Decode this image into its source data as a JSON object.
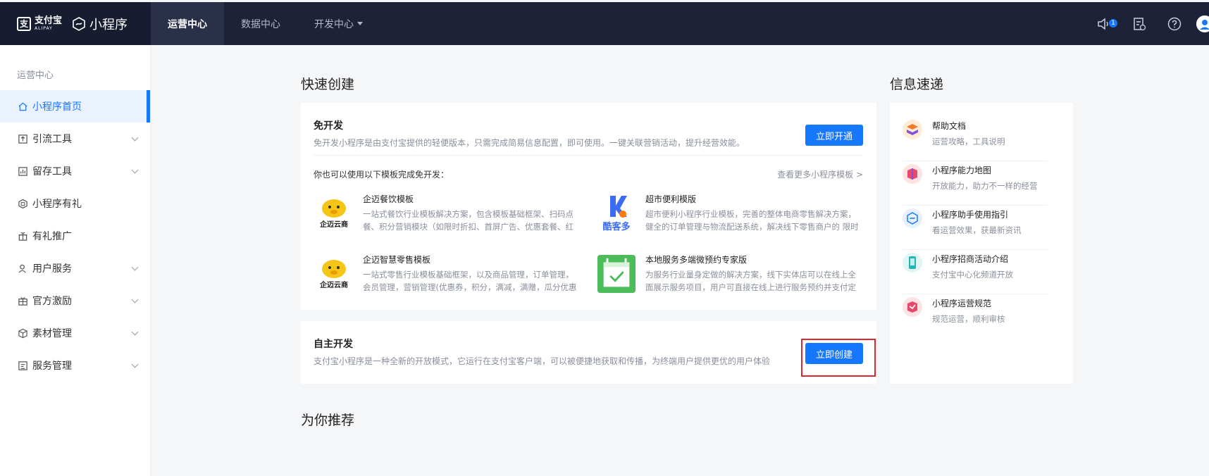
{
  "header": {
    "alipay_cn": "支付宝",
    "alipay_en": "ALIPAY",
    "product": "小程序",
    "nav": [
      {
        "label": "运营中心",
        "active": true
      },
      {
        "label": "数据中心",
        "active": false
      },
      {
        "label": "开发中心",
        "active": false,
        "dropdown": true
      }
    ],
    "notify_badge": "1",
    "right_icons": [
      "speaker-icon",
      "document-icon",
      "help-icon",
      "avatar"
    ]
  },
  "sidebar": {
    "section": "运营中心",
    "items": [
      {
        "label": "小程序首页",
        "icon": "home-icon",
        "active": true
      },
      {
        "label": "引流工具",
        "icon": "upload-icon",
        "expandable": true
      },
      {
        "label": "留存工具",
        "icon": "bar-chart-icon",
        "expandable": true
      },
      {
        "label": "小程序有礼",
        "icon": "gift-hex-icon"
      },
      {
        "label": "有礼推广",
        "icon": "gift-icon"
      },
      {
        "label": "用户服务",
        "icon": "user-icon",
        "expandable": true
      },
      {
        "label": "官方激励",
        "icon": "reward-icon",
        "expandable": true
      },
      {
        "label": "素材管理",
        "icon": "cube-icon",
        "expandable": true
      },
      {
        "label": "服务管理",
        "icon": "service-icon",
        "expandable": true
      }
    ]
  },
  "quick_create": {
    "title": "快速创建",
    "free_dev": {
      "title": "免开发",
      "desc": "免开发小程序是由支付宝提供的轻便版本，只需完成简易信息配置，即可使用。一键关联营销活动，提升经营效能。",
      "button": "立即开通",
      "hint": "你也可以使用以下模板完成免开发：",
      "more": "查看更多小程序模板 >",
      "templates": [
        {
          "name": "企迈餐饮模板",
          "logo": "企迈云商",
          "desc": "一站式餐饮行业模板解决方案，包含模板基础框架、扫码点餐、积分营销模块（如限时折扣、首屏广告、优惠套餐、红包、优..."
        },
        {
          "name": "超市便利模版",
          "logo": "酷客多",
          "desc": "超市便利小程序行业模板，完善的整体电商零售解决方案，健全的订单管理与物流配送系统，解决线下零售商户的 限时特价 ..."
        },
        {
          "name": "企迈智慧零售模板",
          "logo": "企迈云商",
          "desc": "一站式零售行业模板基础框架，以及商品管理，订单管理，会员管理，营销管理(优惠券，积分，满减，满赠，瓜分优惠券/红..."
        },
        {
          "name": "本地服务多端微预约专家版",
          "logo": "",
          "desc": "为服务行业量身定做的解决方案，线下实体店可以在线上全面展示服务项目，用户可直接在线上进行服务预约并支付定金。"
        }
      ]
    },
    "self_dev": {
      "title": "自主开发",
      "desc": "支付宝小程序是一种全新的开放模式，它运行在支付宝客户端，可以被便捷地获取和传播，为终端用户提供更优的用户体验",
      "button": "立即创建"
    }
  },
  "recommend": {
    "title": "为你推荐"
  },
  "info": {
    "title": "信息速递",
    "items": [
      {
        "title": "帮助文档",
        "sub": "运营攻略，工具说明"
      },
      {
        "title": "小程序能力地图",
        "sub": "开放能力，助力不一样的经营"
      },
      {
        "title": "小程序助手使用指引",
        "sub": "看运营效果，获最新资讯"
      },
      {
        "title": "小程序招商活动介绍",
        "sub": "支付宝中心化频道开放"
      },
      {
        "title": "小程序运营规范",
        "sub": "规范运营，顺利审核"
      }
    ]
  },
  "colors": {
    "topbar": "#1e2238",
    "accent": "#1677ff",
    "highlight": "#e0262d"
  }
}
